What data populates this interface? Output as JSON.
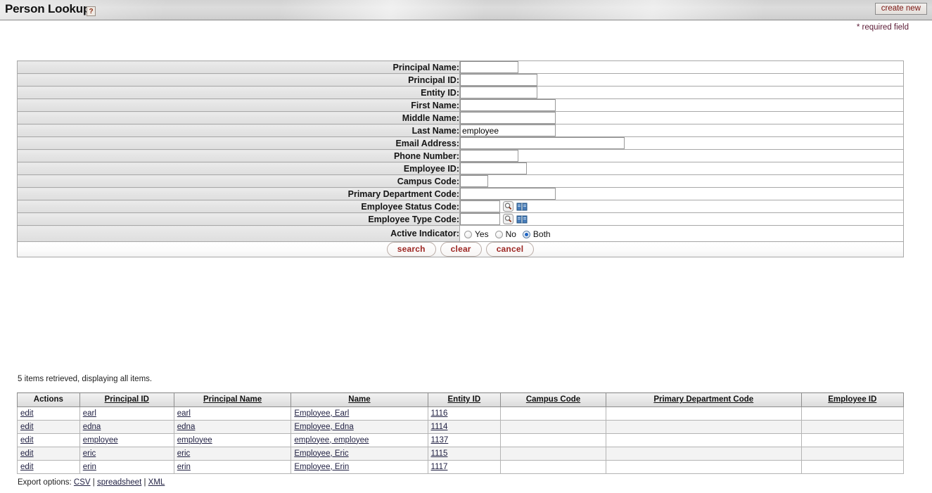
{
  "header": {
    "title": "Person Lookup",
    "help_icon_label": "?",
    "create_new_label": "create new",
    "required_note": "* required field"
  },
  "criteria": {
    "rows": [
      {
        "label": "Principal Name:",
        "value": "",
        "size": "w-xl",
        "lookup": false
      },
      {
        "label": "Principal ID:",
        "value": "",
        "size": "w-2xl",
        "lookup": false
      },
      {
        "label": "Entity ID:",
        "value": "",
        "size": "w-2xl",
        "lookup": false
      },
      {
        "label": "First Name:",
        "value": "",
        "size": "w-3xl",
        "lookup": false
      },
      {
        "label": "Middle Name:",
        "value": "",
        "size": "w-3xl",
        "lookup": false
      },
      {
        "label": "Last Name:",
        "value": "employee",
        "size": "w-3xl",
        "lookup": false
      },
      {
        "label": "Email Address:",
        "value": "",
        "size": "w-email",
        "lookup": false
      },
      {
        "label": "Phone Number:",
        "value": "",
        "size": "w-xl",
        "lookup": false
      },
      {
        "label": "Employee ID:",
        "value": "",
        "size": "w-empid",
        "lookup": false
      },
      {
        "label": "Campus Code:",
        "value": "",
        "size": "w-xs",
        "lookup": false
      },
      {
        "label": "Primary Department Code:",
        "value": "",
        "size": "w-3xl",
        "lookup": false
      },
      {
        "label": "Employee Status Code:",
        "value": "",
        "size": "w-sm",
        "lookup": true
      },
      {
        "label": "Employee Type Code:",
        "value": "",
        "size": "w-sm",
        "lookup": true
      }
    ],
    "active_indicator": {
      "label": "Active Indicator:",
      "options": [
        {
          "label": "Yes",
          "selected": false
        },
        {
          "label": "No",
          "selected": false
        },
        {
          "label": "Both",
          "selected": true
        }
      ]
    },
    "buttons": [
      {
        "label": "search"
      },
      {
        "label": "clear"
      },
      {
        "label": "cancel"
      }
    ],
    "icons": {
      "search_lookup": "magnifier-icon",
      "direct_inquiry": "book-icon"
    }
  },
  "results": {
    "retrieved_text": "5 items retrieved, displaying all items.",
    "columns": [
      {
        "label": "Actions",
        "sortable": false
      },
      {
        "label": "Principal ID",
        "sortable": true
      },
      {
        "label": "Principal Name",
        "sortable": true
      },
      {
        "label": "Name",
        "sortable": true
      },
      {
        "label": "Entity ID",
        "sortable": true
      },
      {
        "label": "Campus Code",
        "sortable": true
      },
      {
        "label": "Primary Department Code",
        "sortable": true
      },
      {
        "label": "Employee ID",
        "sortable": true
      }
    ],
    "rows": [
      {
        "action": "edit",
        "principal_id": "earl",
        "principal_name": "earl",
        "name": "Employee, Earl",
        "entity_id": "1116",
        "campus_code": "",
        "dept_code": "",
        "employee_id": ""
      },
      {
        "action": "edit",
        "principal_id": "edna",
        "principal_name": "edna",
        "name": "Employee, Edna",
        "entity_id": "1114",
        "campus_code": "",
        "dept_code": "",
        "employee_id": ""
      },
      {
        "action": "edit",
        "principal_id": "employee",
        "principal_name": "employee",
        "name": "employee, employee",
        "entity_id": "1137",
        "campus_code": "",
        "dept_code": "",
        "employee_id": ""
      },
      {
        "action": "edit",
        "principal_id": "eric",
        "principal_name": "eric",
        "name": "Employee, Eric",
        "entity_id": "1115",
        "campus_code": "",
        "dept_code": "",
        "employee_id": ""
      },
      {
        "action": "edit",
        "principal_id": "erin",
        "principal_name": "erin",
        "name": "Employee, Erin",
        "entity_id": "1117",
        "campus_code": "",
        "dept_code": "",
        "employee_id": ""
      }
    ]
  },
  "export": {
    "label": "Export options:",
    "options": [
      {
        "label": "CSV"
      },
      {
        "label": "spreadsheet"
      },
      {
        "label": "XML"
      }
    ],
    "separator": "|"
  }
}
